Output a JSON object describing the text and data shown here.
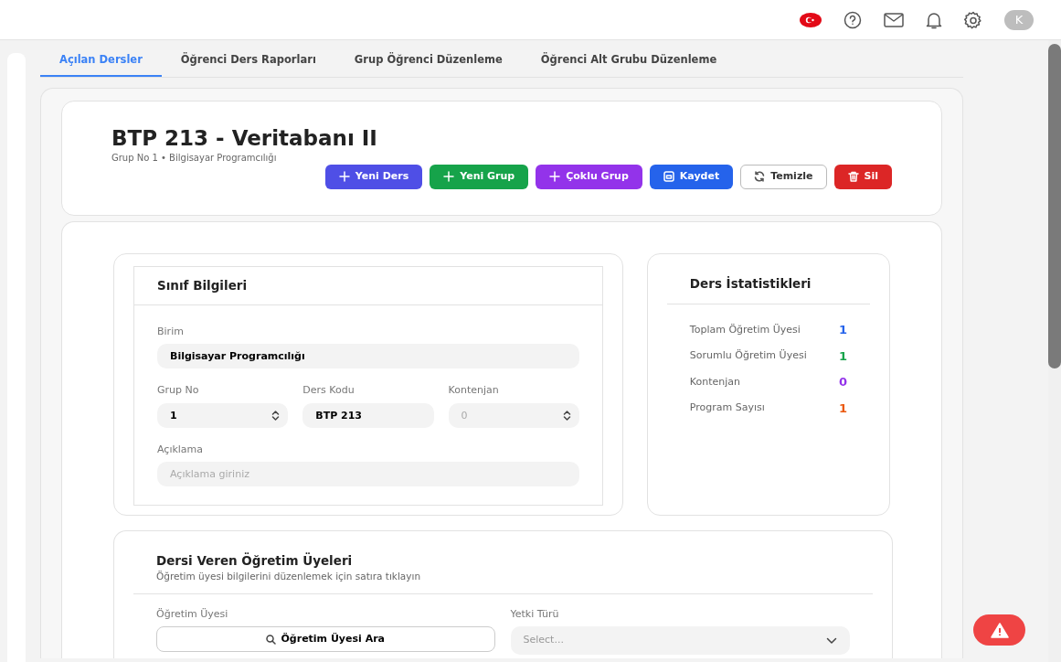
{
  "topbar": {
    "avatar": "K"
  },
  "tabs": [
    {
      "label": "Açılan Dersler",
      "selected": true
    },
    {
      "label": "Öğrenci Ders Raporları",
      "selected": false
    },
    {
      "label": "Grup Öğrenci Düzenleme",
      "selected": false
    },
    {
      "label": "Öğrenci Alt Grubu Düzenleme",
      "selected": false
    }
  ],
  "header": {
    "title": "BTP 213 - Veritabanı II",
    "subtitle": "Grup No 1 • Bilgisayar Programcılığı",
    "buttons": [
      {
        "label": "Yeni Ders",
        "kind": "add",
        "color": "#4f4fe6"
      },
      {
        "label": "Yeni Grup",
        "kind": "add",
        "color": "#16a34a"
      },
      {
        "label": "Çoklu Grup",
        "kind": "add",
        "color": "#9333ea"
      },
      {
        "label": "Kaydet",
        "kind": "save",
        "color": "#2563eb"
      },
      {
        "label": "Temizle",
        "kind": "reset",
        "color": "#ffffff"
      },
      {
        "label": "Sil",
        "kind": "delete",
        "color": "#dc2626"
      }
    ]
  },
  "class_info": {
    "title": "Sınıf Bilgileri",
    "rows": [
      [
        {
          "label": "Birim",
          "kind": "text",
          "value": "Bilgisayar Programcılığı"
        }
      ],
      [
        {
          "label": "Grup No",
          "kind": "number",
          "value": "1"
        },
        {
          "label": "Ders Kodu",
          "kind": "text",
          "value": "BTP 213"
        },
        {
          "label": "Kontenjan",
          "kind": "number",
          "placeholder": "0"
        }
      ],
      [
        {
          "label": "Açıklama",
          "kind": "text",
          "placeholder": "Açıklama giriniz"
        }
      ]
    ]
  },
  "stats": {
    "title": "Ders İstatistikleri",
    "items": [
      {
        "label": "Toplam Öğretim Üyesi",
        "value": "1",
        "color": "#2563eb"
      },
      {
        "label": "Sorumlu Öğretim Üyesi",
        "value": "1",
        "color": "#16a34a"
      },
      {
        "label": "Kontenjan",
        "value": "0",
        "color": "#9333ea"
      },
      {
        "label": "Program Sayısı",
        "value": "1",
        "color": "#ea580c"
      }
    ]
  },
  "instructors": {
    "title": "Dersi Veren Öğretim Üyeleri",
    "subtitle": "Öğretim üyesi bilgilerini düzenlemek için satıra tıklayın",
    "search": {
      "label": "Öğretim Üyesi",
      "button": "Öğretim Üyesi Ara"
    },
    "role": {
      "label": "Yetki Türü",
      "placeholder": "Select..."
    }
  }
}
